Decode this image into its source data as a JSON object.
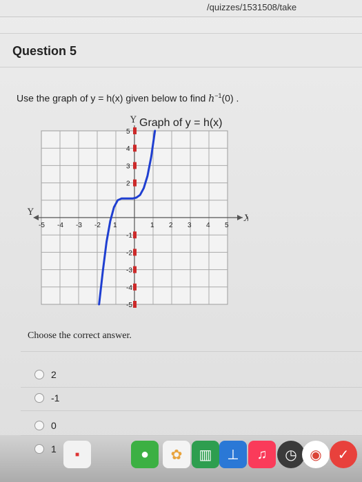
{
  "browser": {
    "url_fragment": "/quizzes/1531508/take"
  },
  "question": {
    "title": "Question 5",
    "prompt_before": "Use the graph of y = h(x) given below to find ",
    "prompt_fn": "h",
    "prompt_exp": "−1",
    "prompt_after": "(0) ."
  },
  "graph": {
    "title": "Graph of y = h(x)",
    "y_axis_label": "Y",
    "x_axis_label": "X"
  },
  "chart_data": {
    "type": "line",
    "title": "Graph of y = h(x)",
    "xlabel": "X",
    "ylabel": "Y",
    "xlim": [
      -5,
      5
    ],
    "ylim": [
      -5,
      5
    ],
    "grid": true,
    "x_ticks": [
      -5,
      -4,
      -3,
      -2,
      -1,
      1,
      2,
      3,
      4,
      5
    ],
    "y_ticks": [
      -5,
      -4,
      -3,
      -2,
      -1,
      1,
      2,
      3,
      4,
      5
    ],
    "x_tick_labels": [
      "-5",
      "-4",
      "-3",
      "-2",
      "1",
      "1",
      "2",
      "3",
      "4",
      "5"
    ],
    "y_tick_labels": [
      "-5",
      "-4",
      "-3",
      "-2",
      "-1",
      "2",
      "3",
      "4",
      "5"
    ],
    "series": [
      {
        "color": "#1f3fd1",
        "x": [
          -1.9,
          -1.7,
          -1.5,
          -1.3,
          -1.1,
          -0.9,
          -0.7,
          -0.5,
          -0.3,
          -0.1,
          0.1,
          0.3,
          0.5,
          0.7,
          0.9,
          1.1
        ],
        "y": [
          -5.0,
          -3.1,
          -1.4,
          -0.2,
          0.6,
          1.0,
          1.1,
          1.1,
          1.1,
          1.1,
          1.15,
          1.3,
          1.7,
          2.4,
          3.5,
          5.0
        ]
      }
    ]
  },
  "choose_text": "Choose the correct answer.",
  "options": [
    {
      "label": "2"
    },
    {
      "label": "-1"
    },
    {
      "label": "0"
    },
    {
      "label": "1"
    }
  ],
  "dock": {
    "items": [
      {
        "icon": "calendar-icon",
        "color": "#f2f2f2"
      },
      {
        "icon": "facetime-icon",
        "color": "#3cb043"
      },
      {
        "icon": "photos-icon",
        "color": "#f4f4f4"
      },
      {
        "icon": "numbers-icon",
        "color": "#2e9e4f"
      },
      {
        "icon": "keynote-icon",
        "color": "#2a78d6"
      },
      {
        "icon": "music-icon",
        "color": "#fa3b5a"
      },
      {
        "icon": "time-machine-icon",
        "color": "#3a3a3a"
      },
      {
        "icon": "chrome-icon",
        "color": "#ffffff"
      },
      {
        "icon": "check-app-icon",
        "color": "#e8413c"
      }
    ]
  }
}
